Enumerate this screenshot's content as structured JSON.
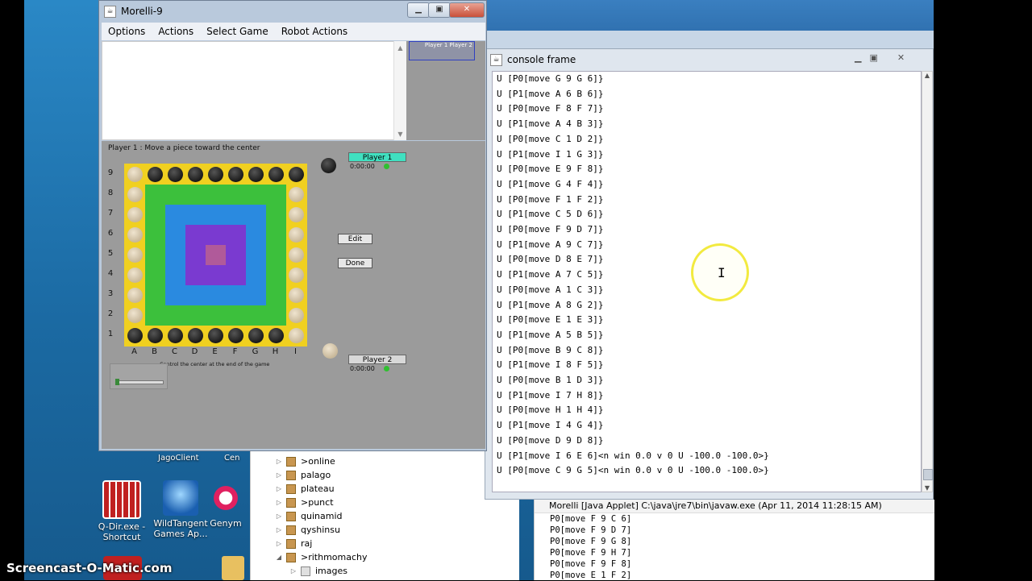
{
  "desktop": {
    "icons": [
      {
        "label": "Q-Dir.exe - Shortcut",
        "name": "qdir-icon"
      },
      {
        "label": "WildTangent Games Ap...",
        "name": "wildtangent-icon"
      },
      {
        "label": "Genym",
        "name": "genymotion-icon"
      }
    ],
    "top_labels": [
      "JagoClient",
      "Cen"
    ],
    "watermark": "Screencast-O-Matic.com"
  },
  "ide": {
    "tree_items": [
      {
        "twist": "▷",
        "label": ">online"
      },
      {
        "twist": "▷",
        "label": "palago"
      },
      {
        "twist": "▷",
        "label": "plateau"
      },
      {
        "twist": "▷",
        "label": ">punct"
      },
      {
        "twist": "▷",
        "label": "quinamid"
      },
      {
        "twist": "▷",
        "label": "qyshinsu"
      },
      {
        "twist": "▷",
        "label": "raj"
      },
      {
        "twist": "◢",
        "label": ">rithmomachy"
      },
      {
        "twist": "▷",
        "label": "images"
      }
    ],
    "console_header": "Morelli [Java Applet] C:\\java\\jre7\\bin\\javaw.exe (Apr 11, 2014 11:28:15 AM)",
    "console_lines": [
      "P0[move F 9 C 6]",
      "P0[move F 9 D 7]",
      "P0[move F 9 G 8]",
      "P0[move F 9 H 7]",
      "P0[move F 9 F 8]",
      "P0[move E 1 F 2]"
    ]
  },
  "morelli": {
    "title": "Morelli-9",
    "menu": [
      "Options",
      "Actions",
      "Select Game",
      "Robot Actions"
    ],
    "mini_legend": "Player 1  Player 2",
    "status": "Player 1 : Move a piece toward the center",
    "rows": [
      "9",
      "8",
      "7",
      "6",
      "5",
      "4",
      "3",
      "2",
      "1"
    ],
    "cols": [
      "A",
      "B",
      "C",
      "D",
      "E",
      "F",
      "G",
      "H",
      "I"
    ],
    "player1": {
      "label": "Player 1",
      "clock": "0:00:00",
      "color": "#40e0c0"
    },
    "player2": {
      "label": "Player 2",
      "clock": "0:00:00",
      "color": "#d8d8d8"
    },
    "buttons": {
      "edit": "Edit",
      "done": "Done"
    },
    "goal_text": "Control the center at the end of the game"
  },
  "console": {
    "title": "console frame",
    "lines": [
      "U [P0[move G 9 G 6]}",
      "U [P1[move A 6 B 6]}",
      "U [P0[move F 8 F 7]}",
      "U [P1[move A 4 B 3]}",
      "U [P0[move C 1 D 2]}",
      "U [P1[move I 1 G 3]}",
      "U [P0[move E 9 F 8]}",
      "U [P1[move G 4 F 4]}",
      "U [P0[move F 1 F 2]}",
      "U [P1[move C 5 D 6]}",
      "U [P0[move F 9 D 7]}",
      "U [P1[move A 9 C 7]}",
      "U [P0[move D 8 E 7]}",
      "U [P1[move A 7 C 5]}",
      "U [P0[move A 1 C 3]}",
      "U [P1[move A 8 G 2]}",
      "U [P0[move E 1 E 3]}",
      "U [P1[move A 5 B 5]}",
      "U [P0[move B 9 C 8]}",
      "U [P1[move I 8 F 5]}",
      "U [P0[move B 1 D 3]}",
      "U [P1[move I 7 H 8]}",
      "U [P0[move H 1 H 4]}",
      "U [P1[move I 4 G 4]}",
      "U [P0[move D 9 D 8]}",
      "U [P1[move I 6 E 6]<n win 0.0 v 0 U -100.0 -100.0>}",
      "U [P0[move C 9 G 5]<n win 0.0 v 0 U -100.0 -100.0>}"
    ]
  },
  "colors": {
    "board_yellow": "#f0d020",
    "ring_green": "#3cc03c",
    "ring_blue": "#2a8ae0",
    "ring_purple": "#7a3ad0",
    "center": "#b05a9a"
  }
}
